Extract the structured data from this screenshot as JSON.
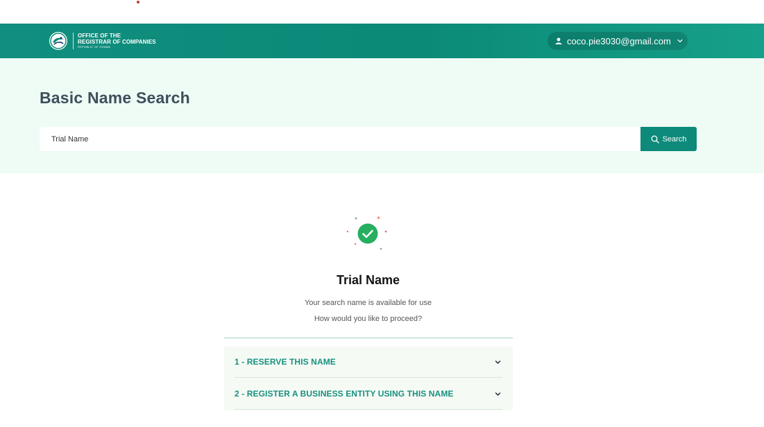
{
  "header": {
    "logo": {
      "line1": "OFFICE OF THE",
      "line2": "REGISTRAR OF COMPANIES",
      "line3": "REPUBLIC OF GHANA"
    },
    "user_email": "coco.pie3030@gmail.com"
  },
  "search": {
    "title": "Basic Name Search",
    "value": "Trial Name",
    "button_label": "Search"
  },
  "result": {
    "name": "Trial Name",
    "status_text": "Your search name is available for use",
    "prompt": "How would you like to proceed?",
    "options": [
      {
        "label": "1 - RESERVE THIS NAME"
      },
      {
        "label": "2 - REGISTER A BUSINESS ENTITY USING THIS NAME"
      }
    ]
  },
  "colors": {
    "brand": "#0b8a78",
    "panel": "#effbf5",
    "accent_text": "#17907f",
    "success": "#27ae60"
  }
}
